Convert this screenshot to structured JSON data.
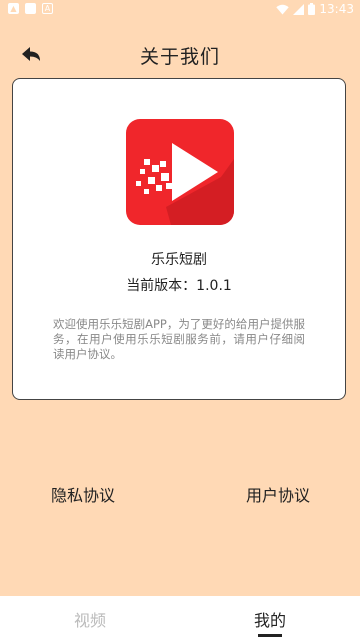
{
  "status_bar": {
    "time": "13:43",
    "left_icons": [
      "image-icon",
      "square-icon",
      "a-icon"
    ],
    "a_icon_text": "A",
    "right_icons": [
      "wifi-icon",
      "signal-icon",
      "battery-icon"
    ]
  },
  "header": {
    "title": "关于我们",
    "back_icon": "back-arrow-icon"
  },
  "about": {
    "app_name": "乐乐短剧",
    "version": "当前版本：1.0.1",
    "description": "欢迎使用乐乐短剧APP，为了更好的给用户提供服务，在用户使用乐乐短剧服务前，请用户仔细阅读用户协议。"
  },
  "links": {
    "privacy": "隐私协议",
    "user_agreement": "用户协议"
  },
  "bottom_nav": {
    "tabs": [
      {
        "label": "视频",
        "active": false
      },
      {
        "label": "我的",
        "active": true
      }
    ]
  },
  "colors": {
    "background": "#FFD9B5",
    "logo_red": "#F0262B",
    "text": "#222222",
    "muted": "#888888"
  }
}
